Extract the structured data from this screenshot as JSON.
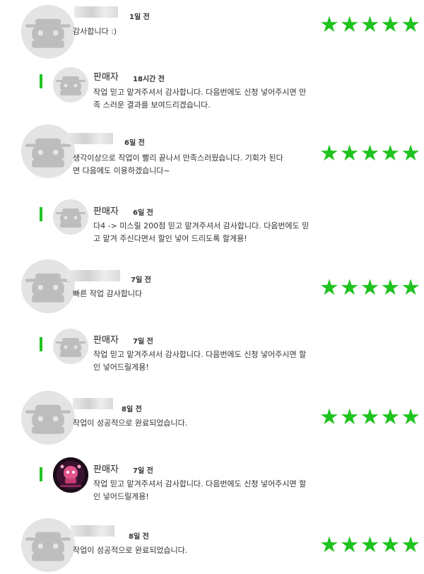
{
  "colors": {
    "accent": "#21c422",
    "star": "#1fc21e",
    "avatar": "#e4e4e4"
  },
  "reviews": [
    {
      "time": "1일 전",
      "lines": [
        "감사합니다 :)"
      ],
      "stars": 5,
      "reply": {
        "label": "판매자",
        "time": "18시간 전",
        "lines": [
          "작업 믿고 맡겨주셔서 감사합니다. 다음번에도 신청 넣어주시면 만",
          "족 스러운 결과를 보여드리겠습니다."
        ]
      }
    },
    {
      "time": "6일 전",
      "lines": [
        "생각이상으로 작업이 빨리 끝나서 만족스러웠습니다. 기회가 된다",
        "면 다음에도 이용하겠습니다~"
      ],
      "stars": 5,
      "reply": {
        "label": "판매자",
        "time": "6일 전",
        "lines": [
          "다4 -> 미스릴 200점 믿고 맡겨주셔서 감사합니다. 다음번에도 믿",
          "고 맡겨 주신다면서 할인 넣어 드리도록 할게용!"
        ]
      }
    },
    {
      "time": "7일 전",
      "lines": [
        "빠른 작업 감사합니다"
      ],
      "stars": 5,
      "reply": {
        "label": "판매자",
        "time": "7일 전",
        "lines": [
          "작업 믿고 맡겨주셔서 감사합니다. 다음번에도 신청 넣어주시면 할",
          "인 넣어드릴게용!"
        ]
      }
    },
    {
      "time": "8일 전",
      "lines": [
        "작업이 성공적으로 완료되었습니다."
      ],
      "stars": 5,
      "reply": {
        "label": "판매자",
        "time": "7일 전",
        "lines": [
          "작업 믿고 맡겨주셔서 감사합니다. 다음번에도 신청 넣어주시면 할",
          "인 넣어드릴게용!"
        ]
      }
    },
    {
      "time": "8일 전",
      "lines": [
        "작업이 성공적으로 완료되었습니다."
      ],
      "stars": 5
    }
  ]
}
